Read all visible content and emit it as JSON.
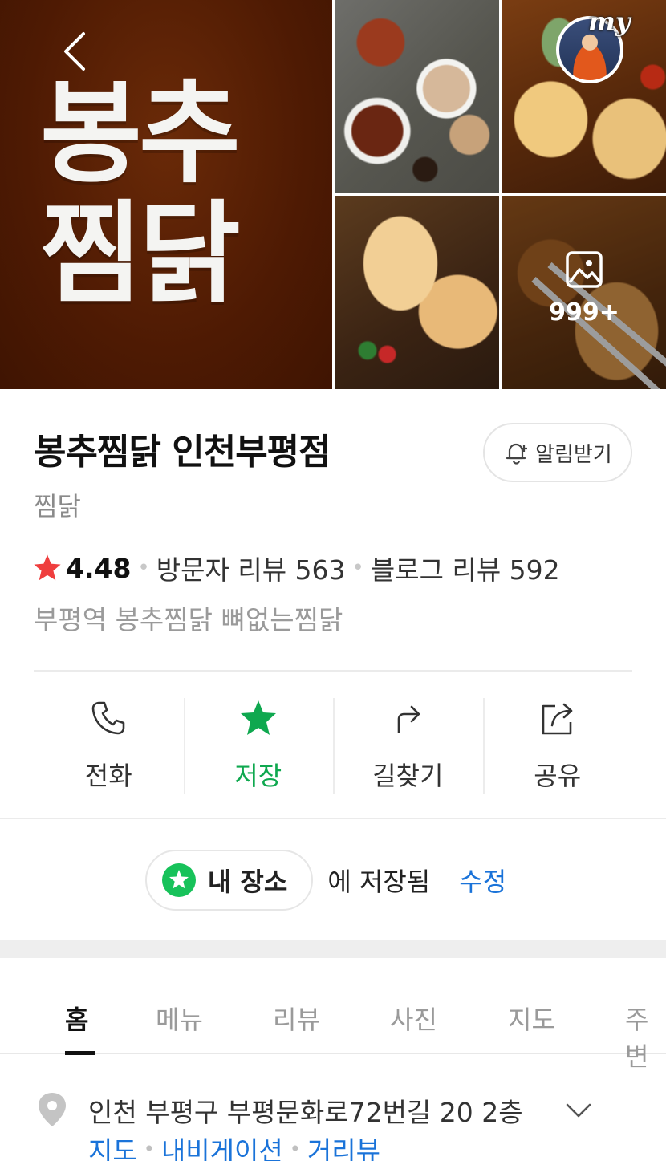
{
  "photos": {
    "logo_line1": "봉추",
    "logo_line2": "찜닭",
    "photo_count": "999+",
    "my_badge": "my"
  },
  "place": {
    "name": "봉추찜닭 인천부평점",
    "category": "찜닭",
    "notify_label": "알림받기",
    "rating": "4.48",
    "visitor_reviews": "방문자 리뷰 563",
    "blog_reviews": "블로그 리뷰 592",
    "description": "부평역 봉추찜닭 뼈없는찜닭"
  },
  "actions": [
    {
      "label": "전화",
      "icon": "phone-icon"
    },
    {
      "label": "저장",
      "icon": "star-icon"
    },
    {
      "label": "길찾기",
      "icon": "directions-arrow-icon"
    },
    {
      "label": "공유",
      "icon": "share-icon"
    }
  ],
  "saved": {
    "chip_label": "내 장소",
    "saved_text": "에 저장됨",
    "edit_label": "수정"
  },
  "tabs": [
    "홈",
    "메뉴",
    "리뷰",
    "사진",
    "지도",
    "주변"
  ],
  "address": {
    "text": "인천 부평구 부평문화로72번길 20 2층",
    "links": [
      "지도",
      "내비게이션",
      "거리뷰"
    ]
  },
  "colors": {
    "accent_green": "#0fa84f",
    "link_blue": "#1a73d9",
    "rating_star": "#ef3e3e",
    "logo_bg": "#4e1a03"
  }
}
